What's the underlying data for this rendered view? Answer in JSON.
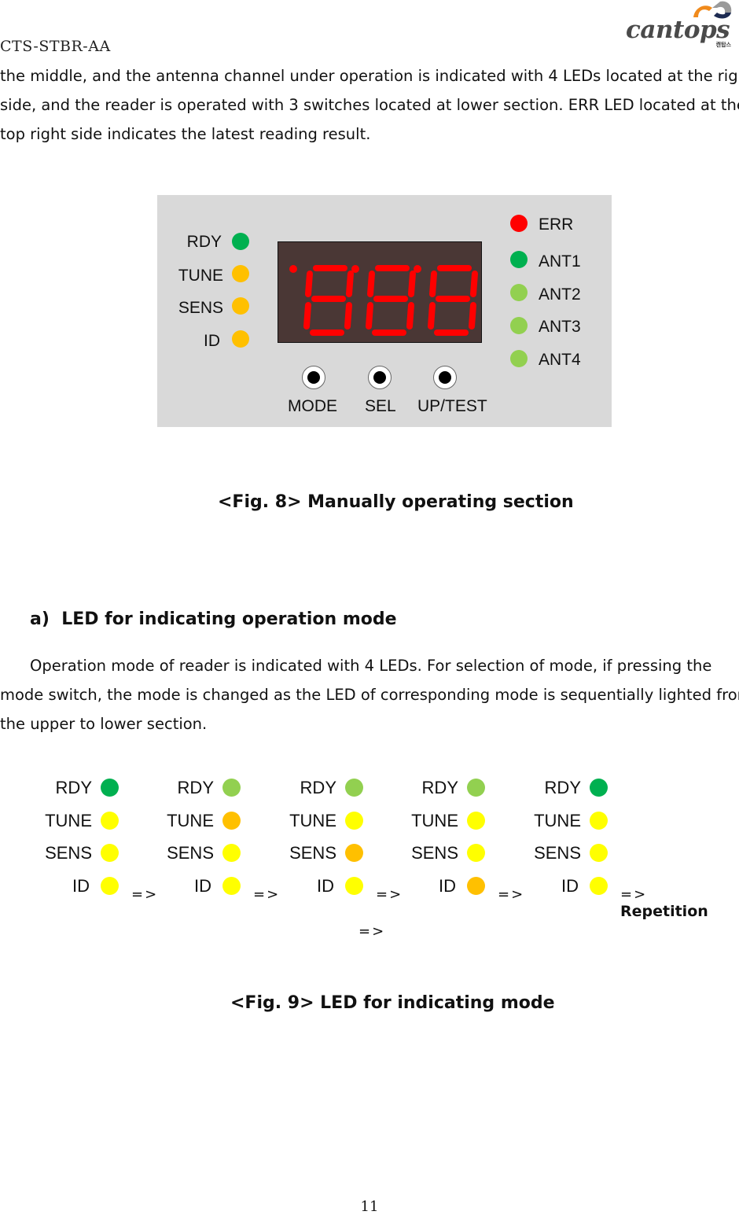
{
  "header": {
    "doc_code": "CTS-STBR-AA",
    "logo": {
      "brand": "cantops",
      "sub": "캔탑스",
      "colors": {
        "orange": "#f08a1c",
        "blue": "#1d2b52",
        "gray": "#4a4a4a"
      }
    }
  },
  "intro_paragraph": {
    "lines": [
      "the middle, and the antenna channel under operation is indicated with 4 LEDs located at the right",
      "side, and the reader is operated with 3 switches located at lower section. ERR LED located at the",
      "top right side indicates the latest reading result."
    ]
  },
  "fig8": {
    "left_leds": [
      {
        "label": "RDY",
        "color": "#00b050"
      },
      {
        "label": "TUNE",
        "color": "#ffc000"
      },
      {
        "label": "SENS",
        "color": "#ffc000"
      },
      {
        "label": "ID",
        "color": "#ffc000"
      }
    ],
    "display": {
      "digits": [
        "8",
        "8",
        "8"
      ],
      "segment_color": "#ff0000",
      "background": "#4a3735"
    },
    "right_leds": [
      {
        "label": "ERR",
        "color": "#ff0000"
      },
      {
        "label": "ANT1",
        "color": "#00b050"
      },
      {
        "label": "ANT2",
        "color": "#92d050"
      },
      {
        "label": "ANT3",
        "color": "#92d050"
      },
      {
        "label": "ANT4",
        "color": "#92d050"
      }
    ],
    "switches": [
      {
        "label": "MODE"
      },
      {
        "label": "SEL"
      },
      {
        "label": "UP/TEST"
      }
    ],
    "caption": "<Fig. 8> Manually operating section"
  },
  "section_a": {
    "heading": "a)  LED for indicating operation mode",
    "lines": [
      "Operation mode of reader is indicated with 4 LEDs. For selection of mode, if pressing the",
      "mode switch, the mode is changed as the LED of corresponding mode is sequentially lighted from",
      "the upper to lower section."
    ]
  },
  "fig9": {
    "labels": [
      "RDY",
      "TUNE",
      "SENS",
      "ID"
    ],
    "states": [
      {
        "colors": [
          "#00b050",
          "#ffff00",
          "#ffff00",
          "#ffff00"
        ],
        "arrow": "=>"
      },
      {
        "colors": [
          "#92d050",
          "#ffc000",
          "#ffff00",
          "#ffff00"
        ],
        "arrow": "=>"
      },
      {
        "colors": [
          "#92d050",
          "#ffff00",
          "#ffc000",
          "#ffff00"
        ],
        "arrow": "=>"
      },
      {
        "colors": [
          "#92d050",
          "#ffff00",
          "#ffff00",
          "#ffc000"
        ],
        "arrow": "=>"
      },
      {
        "colors": [
          "#00b050",
          "#ffff00",
          "#ffff00",
          "#ffff00"
        ],
        "arrow": "=> Repetition"
      }
    ],
    "extra_arrow": "=>",
    "caption": "<Fig. 9> LED for indicating mode"
  },
  "footer": {
    "page_number": "11"
  }
}
